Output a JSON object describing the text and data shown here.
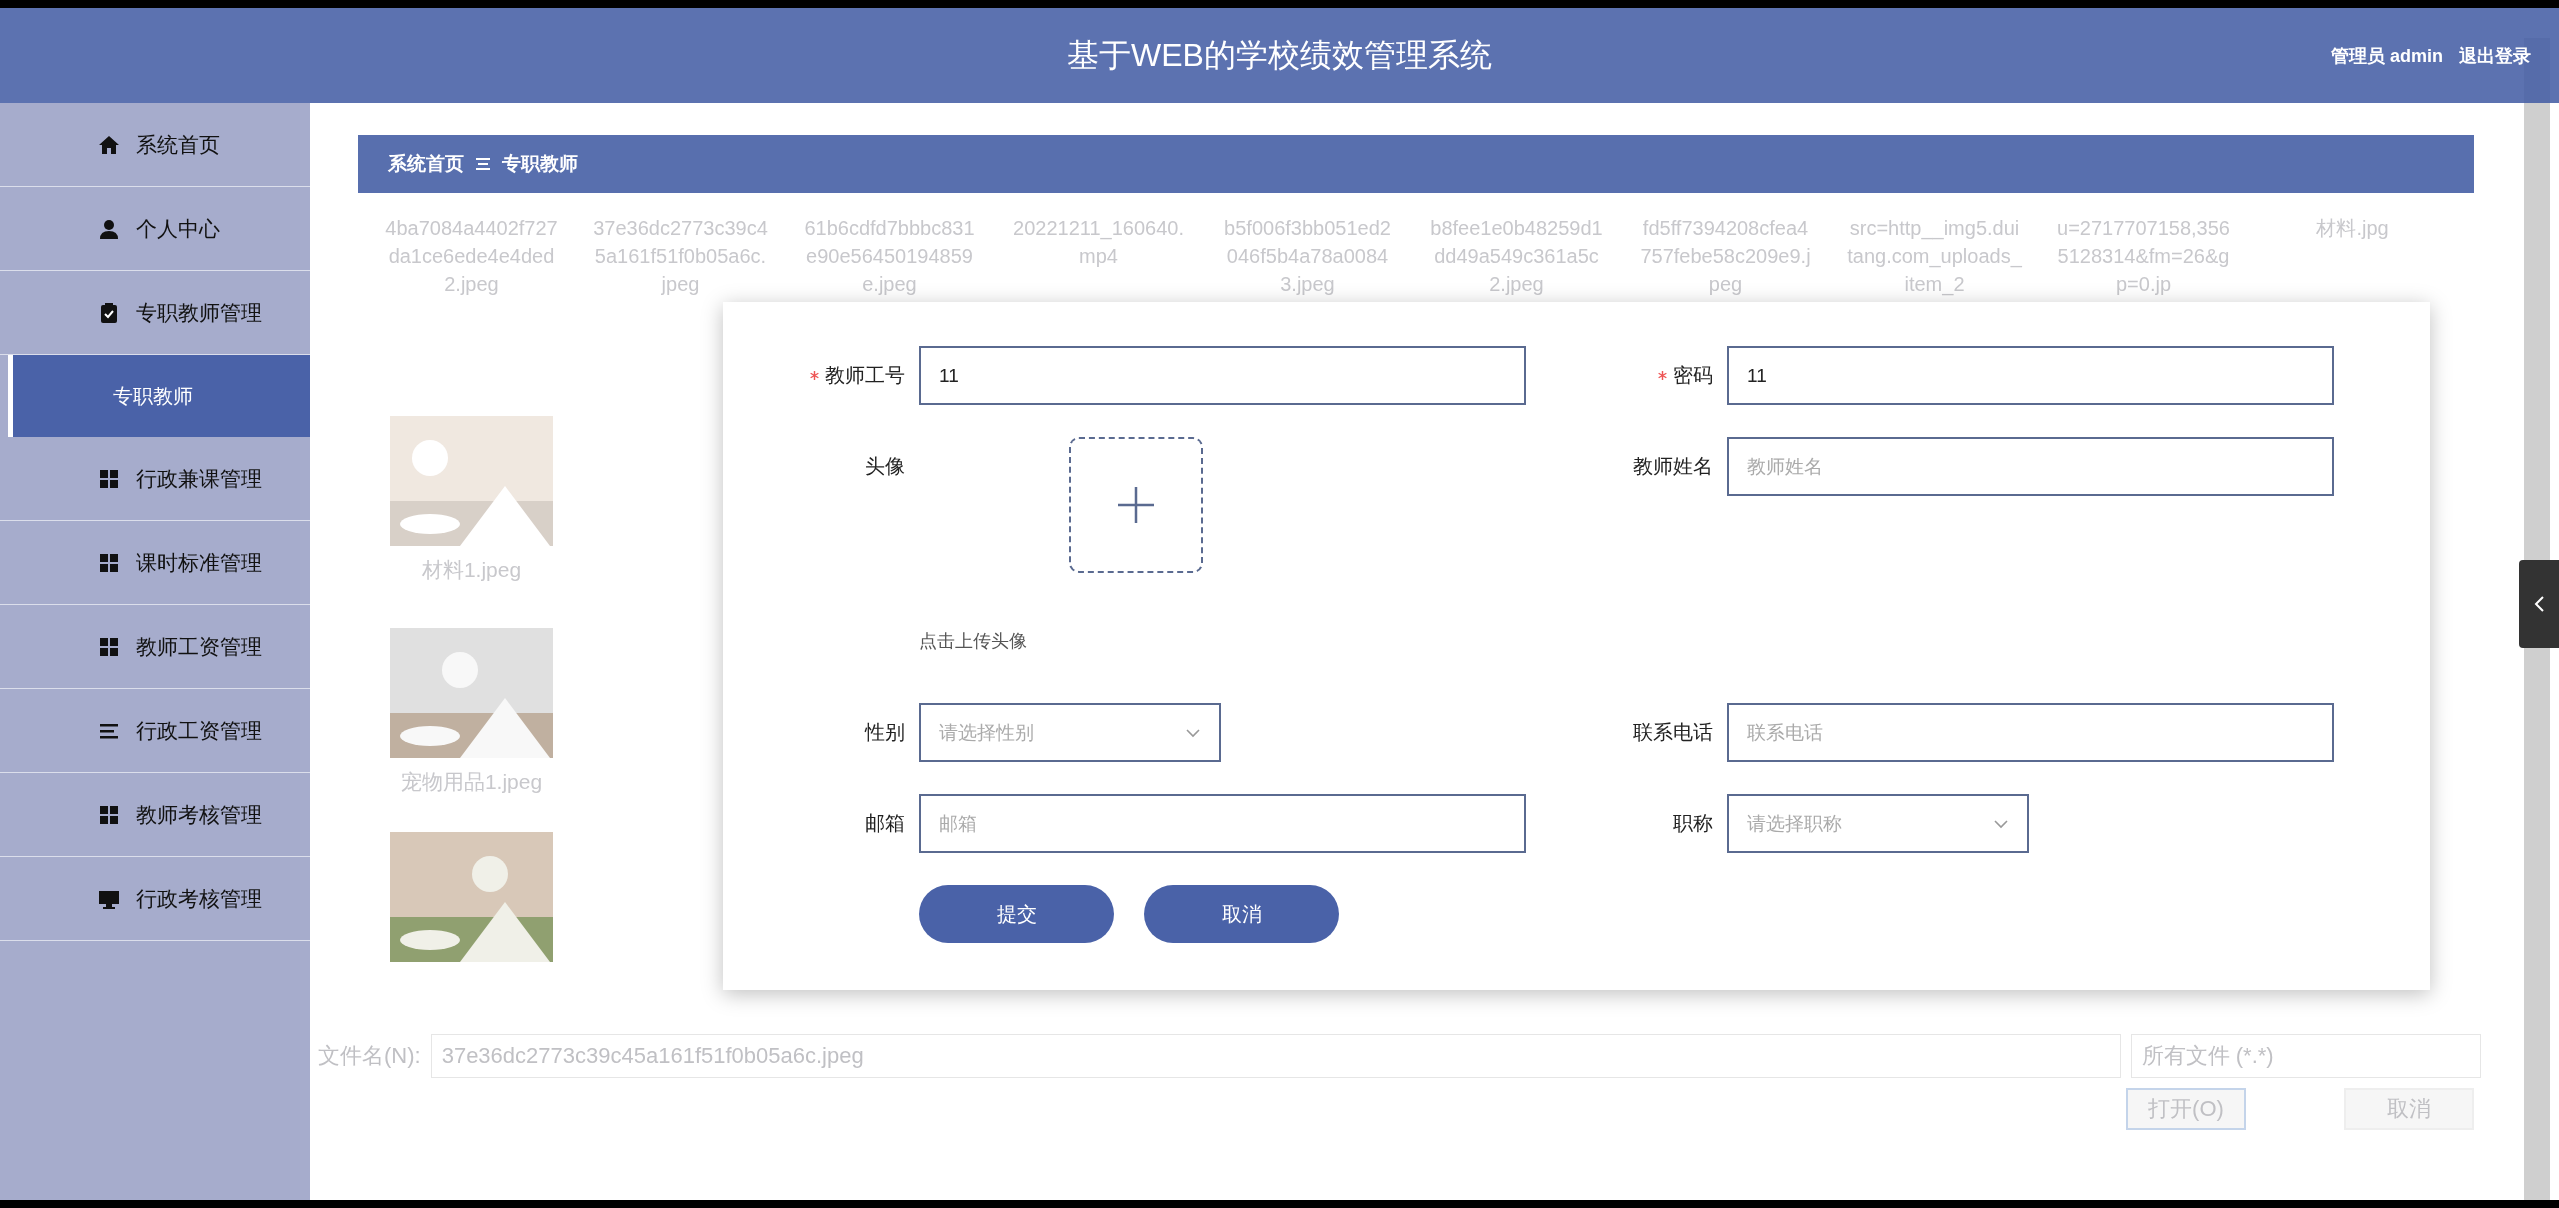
{
  "header": {
    "title": "基于WEB的学校绩效管理系统",
    "user": "管理员 admin",
    "logout": "退出登录"
  },
  "sidebar": {
    "items": [
      {
        "label": "系统首页",
        "selected": false
      },
      {
        "label": "个人中心",
        "selected": false
      },
      {
        "label": "专职教师管理",
        "selected": false,
        "expanded": true,
        "children": [
          {
            "label": "专职教师",
            "selected": true
          }
        ]
      },
      {
        "label": "行政兼课管理",
        "selected": false
      },
      {
        "label": "课时标准管理",
        "selected": false
      },
      {
        "label": "教师工资管理",
        "selected": false
      },
      {
        "label": "行政工资管理",
        "selected": false
      },
      {
        "label": "教师考核管理",
        "selected": false
      },
      {
        "label": "行政考核管理",
        "selected": false
      }
    ]
  },
  "breadcrumb": [
    "系统首页",
    "专职教师"
  ],
  "form": {
    "fields": [
      {
        "kind": "input",
        "label": "教师工号",
        "required": true,
        "value": "11"
      },
      {
        "kind": "input",
        "label": "密码",
        "required": true,
        "value": "11"
      },
      {
        "kind": "upload",
        "label": "头像",
        "required": false,
        "hint": "点击上传头像"
      },
      {
        "kind": "input",
        "label": "教师姓名",
        "required": false,
        "placeholder": "教师姓名"
      },
      {
        "kind": "select",
        "label": "性别",
        "required": false,
        "placeholder": "请选择性别"
      },
      {
        "kind": "input",
        "label": "联系电话",
        "required": false,
        "placeholder": "联系电话"
      },
      {
        "kind": "input",
        "label": "邮箱",
        "required": false,
        "placeholder": "邮箱"
      },
      {
        "kind": "select",
        "label": "职称",
        "required": false,
        "placeholder": "请选择职称"
      }
    ],
    "buttons": [
      "提交",
      "取消"
    ]
  },
  "file_dialog": {
    "top_row": [
      "4ba7084a4402f727da1ce6ede4e4ded2.jpeg",
      "37e36dc2773c39c45a161f51f0b05a6c.jpeg",
      "61b6cdfd7bbbc831e90e56450194859e.jpeg",
      "20221211_160640.mp4",
      "b5f006f3bb051ed2046f5b4a78a00843.jpeg",
      "b8fee1e0b48259d1dd49a549c361a5c2.jpeg",
      "fd5ff7394208cfea4757febe58c209e9.jpeg",
      "src=http__img5.duitang.com_uploads_item_2",
      "u=2717707158,3565128314&fm=26&gp=0.jp",
      "材料.jpg"
    ],
    "left_column": [
      {
        "kind": "file",
        "name": "材料1.jpeg"
      },
      {
        "kind": "file",
        "name": "宠物用品1.jpeg"
      },
      {
        "kind": "picture"
      }
    ],
    "filename_label": "文件名(N):",
    "filename": "37e36dc2773c39c45a161f51f0b05a6c.jpeg",
    "filter": "所有文件 (*.*)",
    "buttons": [
      "打开(O)",
      "取消"
    ]
  }
}
